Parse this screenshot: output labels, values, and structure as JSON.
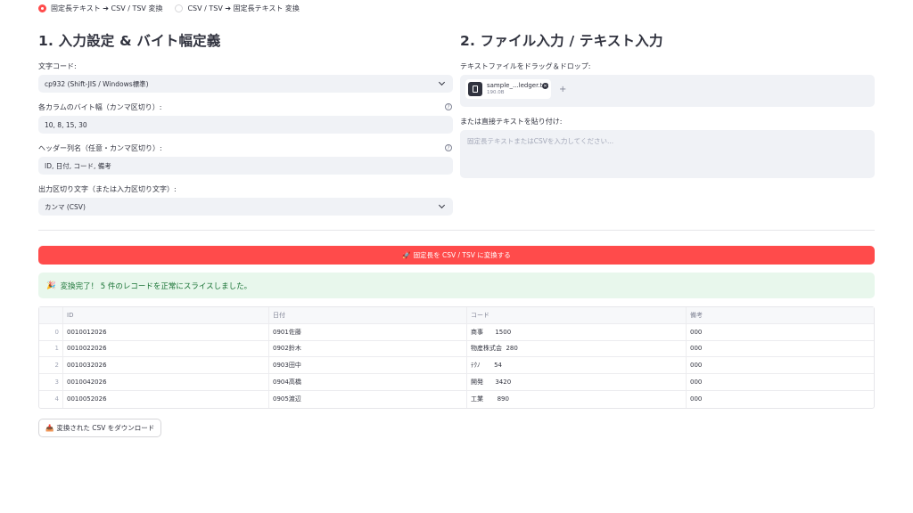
{
  "mode": {
    "options": [
      {
        "label": "固定長テキスト ➔ CSV / TSV 変換",
        "selected": true
      },
      {
        "label": "CSV / TSV ➔ 固定長テキスト 変換",
        "selected": false
      }
    ]
  },
  "left": {
    "title": "1. 入力設定 & バイト幅定義",
    "encoding": {
      "label": "文字コード:",
      "value": "cp932 (Shift-JIS / Windows標準)"
    },
    "widths": {
      "label": "各カラムのバイト幅（カンマ区切り）:",
      "value": "10, 8, 15, 30"
    },
    "headers": {
      "label": "ヘッダー列名（任意・カンマ区切り）:",
      "value": "ID, 日付, コード, 備考"
    },
    "delimiter": {
      "label": "出力区切り文字（または入力区切り文字）:",
      "value": "カンマ (CSV)"
    }
  },
  "right": {
    "title": "2. ファイル入力 / テキスト入力",
    "drop_label": "テキストファイルをドラッグ＆ドロップ:",
    "file": {
      "name": "sample_...ledger.txt",
      "size": "190.0B"
    },
    "paste_label": "または直接テキストを貼り付け:",
    "paste_placeholder": "固定長テキストまたはCSVを入力してください..."
  },
  "convert_button": {
    "icon": "🚀",
    "label": "固定長を CSV / TSV に変換する"
  },
  "success": {
    "icon": "🎉",
    "text": "変換完了！ 5 件のレコードを正常にスライスしました。"
  },
  "table": {
    "columns": [
      "",
      "ID",
      "日付",
      "コード",
      "備考"
    ],
    "rows": [
      [
        "0",
        "0010012026",
        "0901佐藤",
        "商事      1500",
        "000"
      ],
      [
        "1",
        "0010022026",
        "0902鈴木",
        "物産株式会  280",
        "000"
      ],
      [
        "2",
        "0010032026",
        "0903田中",
        "ﾃｸﾉ       54",
        "000"
      ],
      [
        "3",
        "0010042026",
        "0904高橋",
        "開発      3420",
        "000"
      ],
      [
        "4",
        "0010052026",
        "0905渡辺",
        "工業       890",
        "000"
      ]
    ]
  },
  "download_button": {
    "icon": "📥",
    "label": "変換された CSV をダウンロード"
  },
  "colors": {
    "accent": "#ff4b4b",
    "success_bg": "#e8f7ec",
    "success_text": "#177233",
    "input_bg": "#f0f2f6"
  }
}
